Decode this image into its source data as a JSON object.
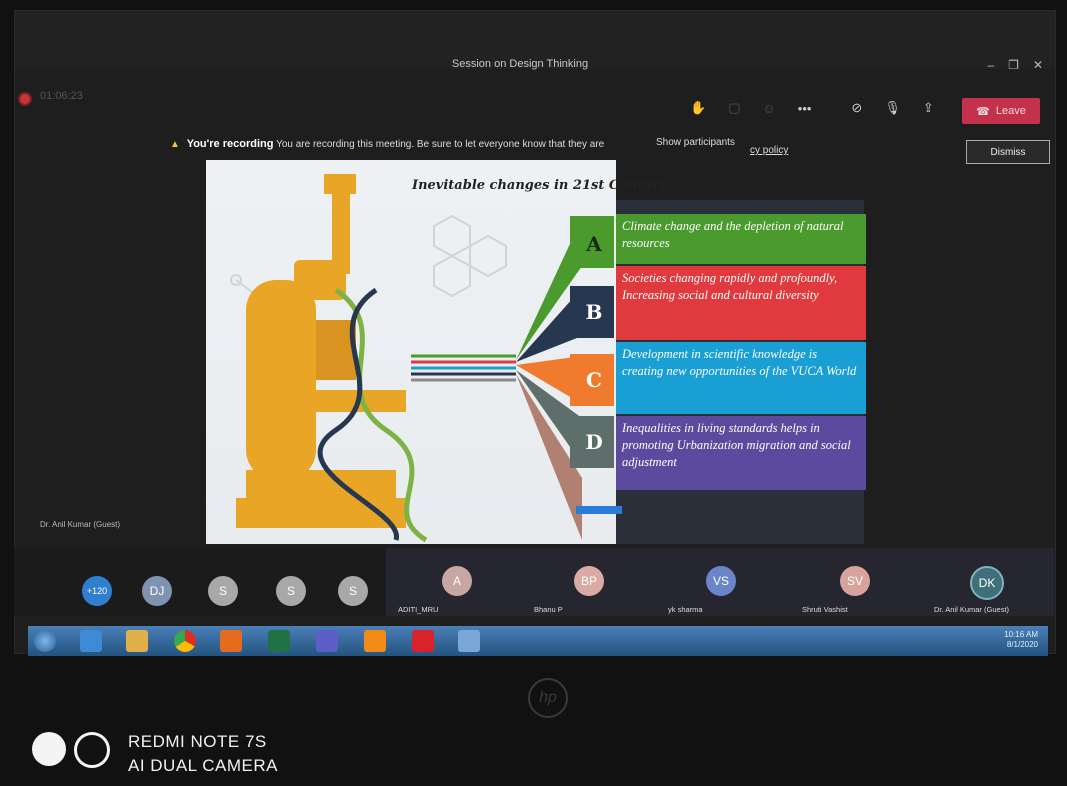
{
  "window": {
    "title": "Session on Design Thinking",
    "timer": "01:06:23"
  },
  "toolbar": {
    "more_label": "•••",
    "leave_label": "Leave"
  },
  "banner": {
    "heading": "You're recording",
    "message": "You are recording this meeting. Be sure to let everyone know that they are",
    "show_participants": "Show participants",
    "policy_link": "cy policy",
    "dismiss_label": "Dismiss"
  },
  "slide": {
    "title": "Inevitable changes in 21st Century",
    "items": [
      {
        "letter": "A",
        "text": "Climate change and the depletion of natural resources",
        "color": "#4a9a2e"
      },
      {
        "letter": "B",
        "text": "Societies changing rapidly and profoundly, Increasing social and cultural diversity",
        "color": "#e0393e"
      },
      {
        "letter": "C",
        "text": "Development in scientific knowledge is creating new opportunities of the VUCA World",
        "color": "#1a9fd4"
      },
      {
        "letter": "D",
        "text": "Inequalities in living standards helps in promoting Urbanization migration and social adjustment",
        "color": "#5b4a9e"
      }
    ]
  },
  "presenter_label": "Dr. Anil Kumar (Guest)",
  "participants": {
    "overflow": "+120",
    "small": [
      "DJ",
      "S",
      "S",
      "S"
    ],
    "tiles": [
      {
        "initials": "A",
        "name": "ADITI_MRU",
        "color": "#c8a6a2"
      },
      {
        "initials": "BP",
        "name": "Bhanu P",
        "color": "#d9aaa6"
      },
      {
        "initials": "VS",
        "name": "yk sharma",
        "color": "#6c84c8"
      },
      {
        "initials": "SV",
        "name": "Shruti Vashist",
        "color": "#d7a39c"
      },
      {
        "initials": "DK",
        "name": "Dr. Anil Kumar (Guest)",
        "color": "#3f6f78"
      }
    ]
  },
  "taskbar": {
    "time": "10:16 AM",
    "date": "8/1/2020"
  },
  "laptop_brand": "hp",
  "watermark": {
    "line1": "REDMI NOTE 7S",
    "line2": "AI DUAL CAMERA"
  }
}
